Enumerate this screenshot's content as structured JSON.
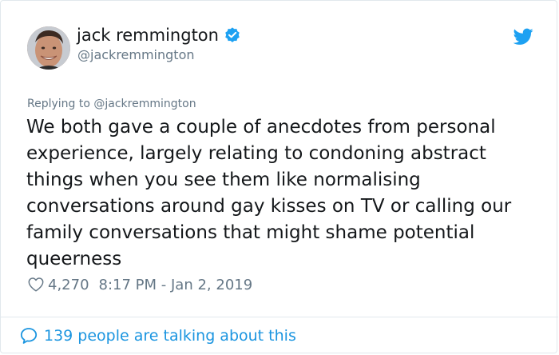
{
  "author": {
    "display_name": "jack remmington",
    "handle": "@jackremmington",
    "verified": true
  },
  "icons": {
    "logo": "twitter-bird-icon",
    "verified": "verified-badge-icon",
    "like": "heart-icon",
    "conversation": "speech-bubble-icon"
  },
  "reply_context": "Replying to @jackremmington",
  "tweet": {
    "text": "We both gave a couple of anecdotes from personal experience, largely relating to condoning abstract things when you see them like normalising conversations around gay kisses on TV or calling our family conversations that might shame potential queerness",
    "likes": "4,270",
    "timestamp": "8:17 PM - Jan 2, 2019"
  },
  "footer": {
    "conversation_label": "139 people are talking about this"
  },
  "colors": {
    "accent": "#1da1f2",
    "link": "#1b95e0",
    "secondary_text": "#657786",
    "border": "#e1e8ed"
  }
}
